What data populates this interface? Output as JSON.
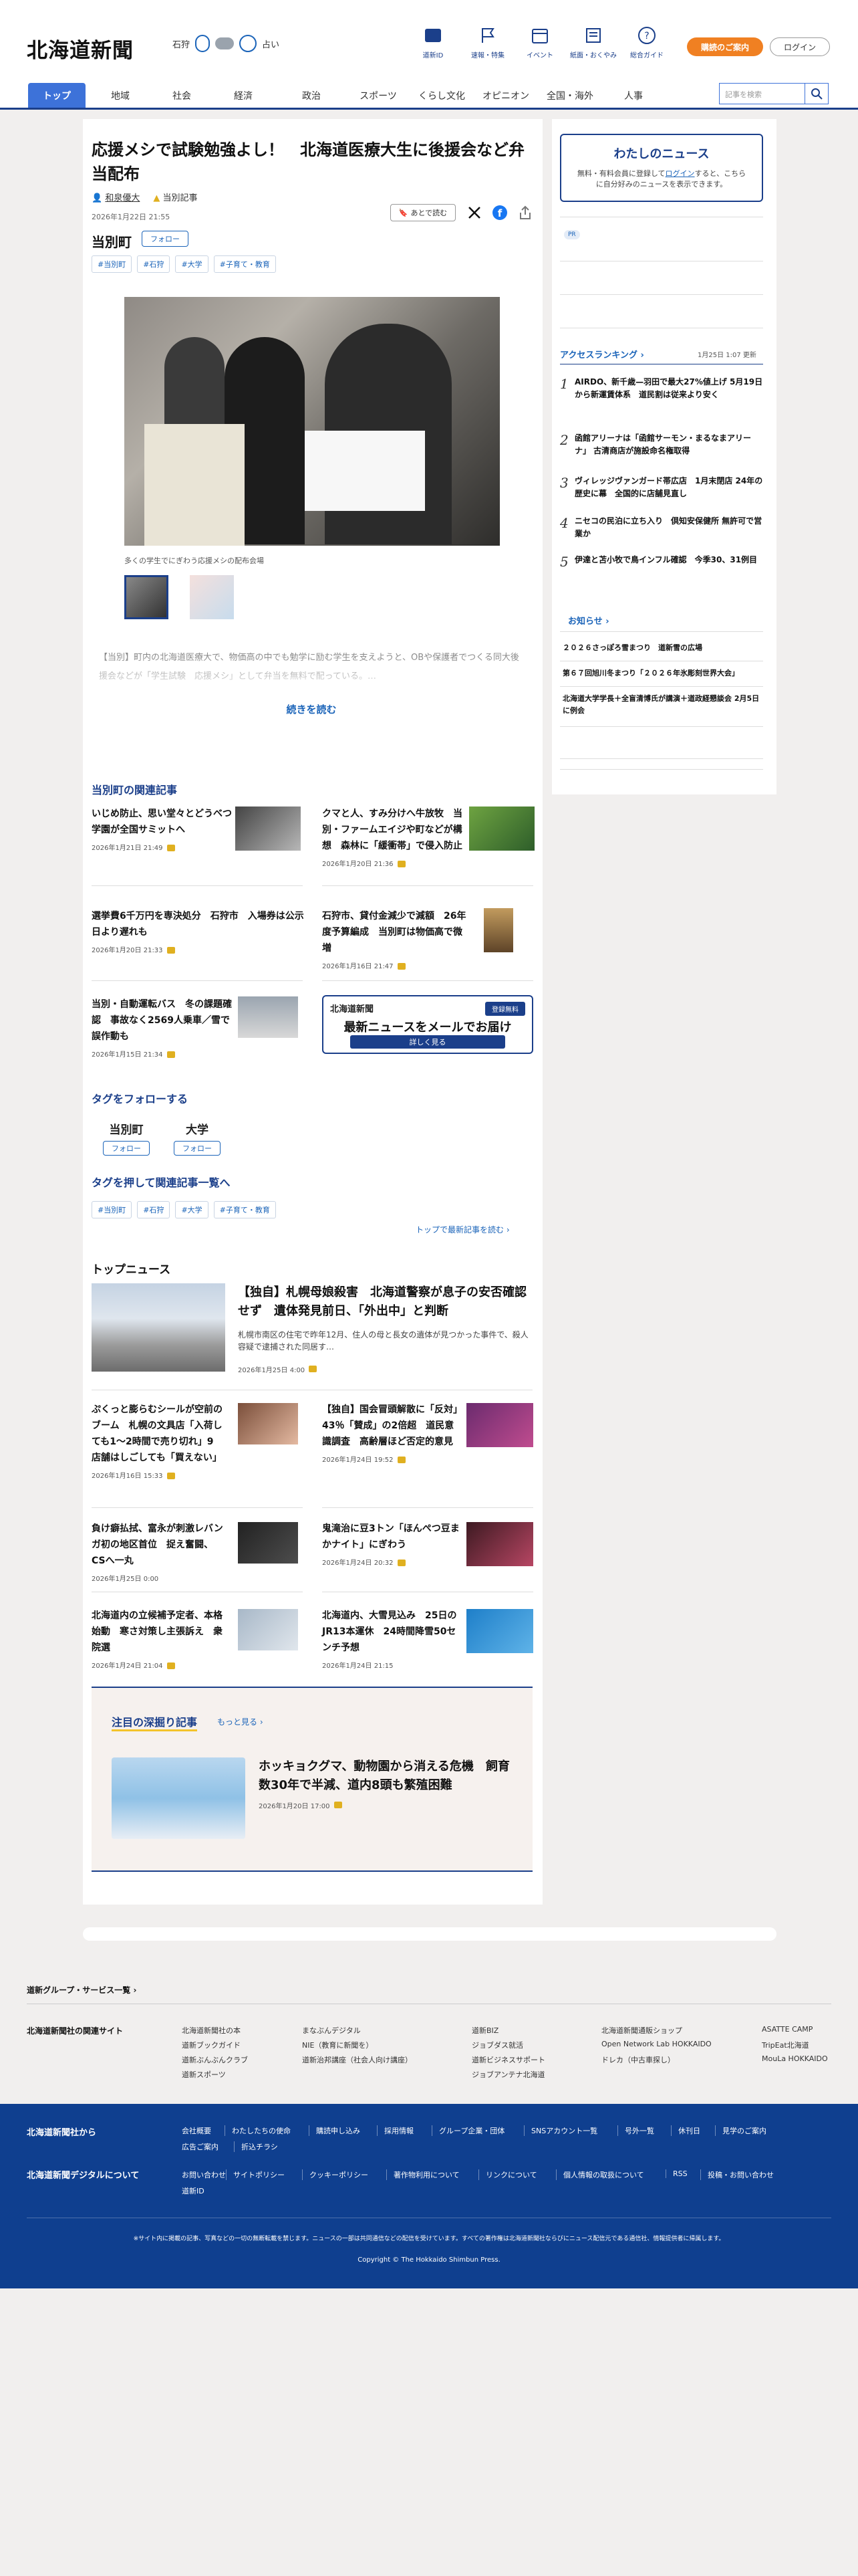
{
  "header": {
    "logo": "北海道新聞",
    "weather_city": "石狩",
    "weather_value": "占い",
    "nav_icons": [
      {
        "label": "道新ID",
        "icon": "book-icon"
      },
      {
        "label": "速報・特集",
        "icon": "flag-icon"
      },
      {
        "label": "イベント",
        "icon": "calendar-icon"
      },
      {
        "label": "紙面・おくやみ",
        "icon": "newspaper-icon"
      },
      {
        "label": "総合ガイド",
        "icon": "question-icon"
      }
    ],
    "subscribe_label": "購読のご案内",
    "login_label": "ログイン"
  },
  "gnav": {
    "tabs": [
      "トップ",
      "地域",
      "社会",
      "経済",
      "政治",
      "スポーツ",
      "くらし文化",
      "オピニオン",
      "全国・海外",
      "人事"
    ],
    "search_placeholder": "記事を検索"
  },
  "article": {
    "title": "応援メシで試験勉強よし！　北海道医療大生に後援会など弁当配布",
    "author": "和泉優大",
    "author_badge": "当別記事",
    "date": "2026年1月22日 21:55",
    "later_label": "あとで読む",
    "location": "当別町",
    "follow_label": "フォロー",
    "tags": [
      "#当別町",
      "#石狩",
      "#大学",
      "#子育て・教育"
    ],
    "caption": "多くの学生でにぎわう応援メシの配布会場",
    "lead": "【当別】町内の北海道医療大で、物価高の中でも勉学に励む学生を支えようと、OBや保護者でつくる同大後援会などが「学生試験　応援メシ」として弁当を無料で配っている。…",
    "read_more": "続きを読む"
  },
  "related": {
    "heading": "当別町の関連記事",
    "items": [
      {
        "title": "いじめ防止、思い堂々とどうべつ学園が全国サミットへ",
        "date": "2026年1月21日 21:49"
      },
      {
        "title": "クマと人、すみ分けへ牛放牧　当別・ファームエイジや町などが構想　森林に「緩衝帯」で侵入防止",
        "date": "2026年1月20日 21:36"
      },
      {
        "title": "選挙費6千万円を専決処分　石狩市　入場券は公示日より遅れも",
        "date": "2026年1月20日 21:33"
      },
      {
        "title": "石狩市、貸付金減少で減額　26年度予算編成　当別町は物価高で微増",
        "date": "2026年1月16日 21:47"
      },
      {
        "title": "当別・自動運転バス　冬の課題確認　事故なく2569人乗車／雪で誤作動も",
        "date": "2026年1月15日 21:34"
      }
    ],
    "mail_header": "北海道新聞",
    "mail_badge": "登録無料",
    "mail_title": "最新ニュースをメールでお届け",
    "mail_cta": "詳しく見る"
  },
  "follow_tags": {
    "heading": "タグをフォローする",
    "items": [
      "当別町",
      "大学"
    ],
    "follow_label": "フォロー"
  },
  "press_tags": {
    "heading": "タグを押して関連記事一覧へ",
    "tags": [
      "#当別町",
      "#石狩",
      "#大学",
      "#子育て・教育"
    ],
    "top_link": "トップで最新記事を読む"
  },
  "top_news": {
    "heading": "トップニュース",
    "lead_title": "【独自】札幌母娘殺害　北海道警察が息子の安否確認せず　遺体発見前日、「外出中」と判断",
    "lead_desc": "札幌市南区の住宅で昨年12月、住人の母と長女の遺体が見つかった事件で、殺人容疑で逮捕された同居す…",
    "lead_date": "2026年1月25日 4:00",
    "items": [
      {
        "title": "ぷくっと膨らむシールが空前のブーム　札幌の文具店「入荷しても1〜2時間で売り切れ」9店舗はしごしても「買えない」",
        "date": "2026年1月16日 15:33"
      },
      {
        "title": "【独自】国会冒頭解散に「反対」43％「賛成」の2倍超　道民意識調査　高齢層ほど否定的意見",
        "date": "2026年1月24日 19:52"
      },
      {
        "title": "負け癖払拭、富永が刺激レバンガ初の地区首位　捉え奮闘、CSへ一丸",
        "date": "2026年1月25日 0:00"
      },
      {
        "title": "鬼滝治に豆3トン「ほんぺつ豆まかナイト」にぎわう",
        "date": "2026年1月24日 20:32"
      },
      {
        "title": "北海道内の立候補予定者、本格始動　寒さ対策し主張訴え　衆院選",
        "date": "2026年1月24日 21:04"
      },
      {
        "title": "北海道内、大雪見込み　25日のJR13本運休　24時間降雪50センチ予想",
        "date": "2026年1月24日 21:15"
      }
    ]
  },
  "deep": {
    "heading": "注目の深掘り記事",
    "more": "もっと見る",
    "title": "ホッキョクグマ、動物園から消える危機　飼育数30年で半減、道内8頭も繁殖困難",
    "date": "2026年1月20日 17:00"
  },
  "sidebar": {
    "mynews_title": "わたしのニュース",
    "mynews_body_1": "無料・有料会員に登録して",
    "mynews_link": "ログイン",
    "mynews_body_2": "すると、こちらに自分好みのニュースを表示できます。",
    "pr_badge": "PR",
    "ranking_heading": "アクセスランキング",
    "ranking_date": "1月25日 1:07 更新",
    "ranking": [
      {
        "no": "1",
        "title": "AIRDO、新千歳—羽田で最大27%値上げ 5月19日から新運賃体系　道民割は従来より安く"
      },
      {
        "no": "2",
        "title": "函館アリーナは「函館サーモン・まるなまアリーナ」 古清商店が施設命名権取得"
      },
      {
        "no": "3",
        "title": "ヴィレッジヴァンガード帯広店　1月末閉店 24年の歴史に幕　全国的に店舗見直し"
      },
      {
        "no": "4",
        "title": "ニセコの民泊に立ち入り　倶知安保健所 無許可で営業か"
      },
      {
        "no": "5",
        "title": "伊達と苫小牧で鳥インフル確認　今季30、31例目"
      }
    ],
    "notice_heading": "お知らせ",
    "notices": [
      "２０２６さっぽろ雪まつり　道新雪の広場",
      "第６７回旭川冬まつり「２０２６年氷彫刻世界大会」",
      "北海道大学学長＋全盲清博氏が講演＋道政経懇談会 2月5日に例会"
    ]
  },
  "footer": {
    "group_link": "道新グループ・サービス一覧",
    "related_heading": "北海道新聞社の関連サイト",
    "related_cols": [
      [
        "北海道新聞社の本",
        "道新ブックガイド",
        "道新ぶんぶんクラブ",
        "道新スポーツ"
      ],
      [
        "まなぶんデジタル",
        "NIE（教育に新聞を）",
        "道新治邦講座（社会人向け講座）"
      ],
      [
        "道新BIZ",
        "ジョブダス就活",
        "道新ビジネスサポート",
        "ジョブアンテナ北海道"
      ],
      [
        "北海道新聞通販ショップ",
        "Open Network Lab HOKKAIDO",
        "ドレカ（中古車探し）"
      ],
      [
        "ASATTE CAMP",
        "TripEat北海道",
        "MouLa HOKKAIDO"
      ]
    ],
    "company_heading": "北海道新聞社から",
    "company_links": [
      "会社概要",
      "わたしたちの使命",
      "購読申し込み",
      "採用情報",
      "グループ企業・団体",
      "SNSアカウント一覧",
      "号外一覧",
      "休刊日",
      "見学のご案内",
      "広告ご案内",
      "折込チラシ"
    ],
    "digital_heading": "北海道新聞デジタルについて",
    "digital_links": [
      "お問い合わせ",
      "サイトポリシー",
      "クッキーポリシー",
      "著作物利用について",
      "リンクについて",
      "個人情報の取扱について",
      "RSS",
      "投稿・お問い合わせ",
      "道新ID"
    ],
    "notice": "※サイト内に掲載の記事、写真などの一切の無断転載を禁じます。ニュースの一部は共同通信などの配信を受けています。すべての著作権は北海道新聞社ならびにニュース配信元である通信社、情報提供者に帰属します。",
    "copyright": "Copyright © The Hokkaido Shimbun Press."
  },
  "colors": {
    "brand": "#1b3f8a",
    "link": "#1b64b9",
    "accent": "#f08022",
    "footer": "#0f3f8f"
  }
}
